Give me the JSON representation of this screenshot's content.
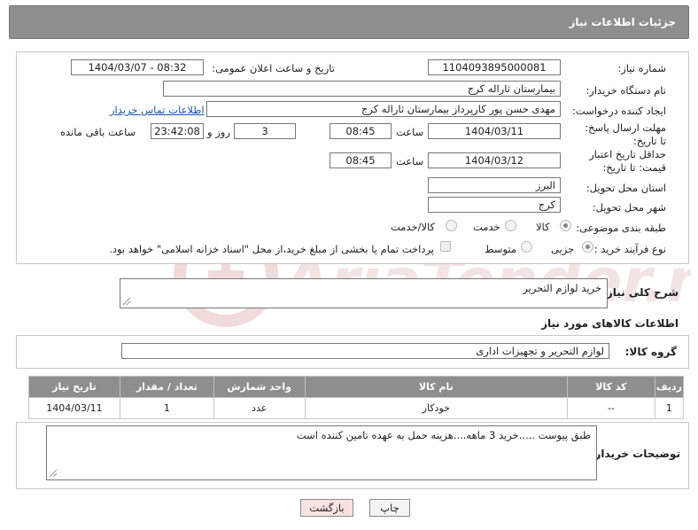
{
  "page": {
    "title": "جزئیات اطلاعات نیاز"
  },
  "form": {
    "need_number_label": "شماره نیاز:",
    "need_number": "1104093895000081",
    "announce_label": "تاریخ و ساعت اعلان عمومی:",
    "announce_value": "1404/03/07 - 08:32",
    "buyer_org_label": "نام دستگاه خریدار:",
    "buyer_org": "بیمارستان ثاراله کرج",
    "creator_label": "ایجاد کننده درخواست:",
    "creator": "مهدی حسن پور کارپرداز بیمارستان ثاراله کرج",
    "contact_link": "اطلاعات تماس خریدار",
    "reply_deadline_label": "مهلت ارسال پاسخ: تا تاریخ:",
    "reply_date": "1404/03/11",
    "time_label": "ساعت",
    "reply_time": "08:45",
    "days_value": "3",
    "days_label": "روز و",
    "remaining_time": "23:42:08",
    "remaining_label": "ساعت باقی مانده",
    "price_validity_label": "حداقل تاریخ اعتبار قیمت: تا تاریخ:",
    "price_date": "1404/03/12",
    "price_time": "08:45",
    "province_label": "استان محل تحویل:",
    "province": "البرز",
    "city_label": "شهر محل تحویل:",
    "city": "کرج",
    "category_label": "طبقه بندی موضوعی:",
    "category_options": [
      "کالا",
      "خدمت",
      "کالا/خدمت"
    ],
    "process_label": "نوع فرآیند خرید :",
    "process_options": [
      "جزیی",
      "متوسط"
    ],
    "payment_note": "پرداخت تمام یا بخشی از مبلغ خرید،از محل \"اسناد خزانه اسلامی\" خواهد بود."
  },
  "description": {
    "label": "شرح کلی نیاز:",
    "value": "خرید لوازم التحریر"
  },
  "goods": {
    "section_title": "اطلاعات کالاهای مورد نیاز",
    "group_label": "گروه کالا:",
    "group_value": "لوازم التحریر و تجهیزات اداری",
    "columns": [
      "ردیف",
      "کد کالا",
      "نام کالا",
      "واحد شمارش",
      "تعداد / مقدار",
      "تاریخ نیاز"
    ],
    "rows": [
      {
        "row": "1",
        "code": "--",
        "name": "خودکار",
        "unit": "عدد",
        "qty": "1",
        "date": "1404/03/11"
      }
    ]
  },
  "buyer_notes": {
    "label": "توضیحات خریدار:",
    "value": "طبق پیوست .....خرید 3 ماهه....هزینه حمل به عهده تامین کننده است"
  },
  "buttons": {
    "print": "چاپ",
    "back": "بازگشت"
  },
  "watermark": {
    "text": "AriaTender.net"
  },
  "colors": {
    "header_bg": "#8e8e8e",
    "link": "#1a55a8",
    "back_button_bg": "#fbe2e2"
  }
}
